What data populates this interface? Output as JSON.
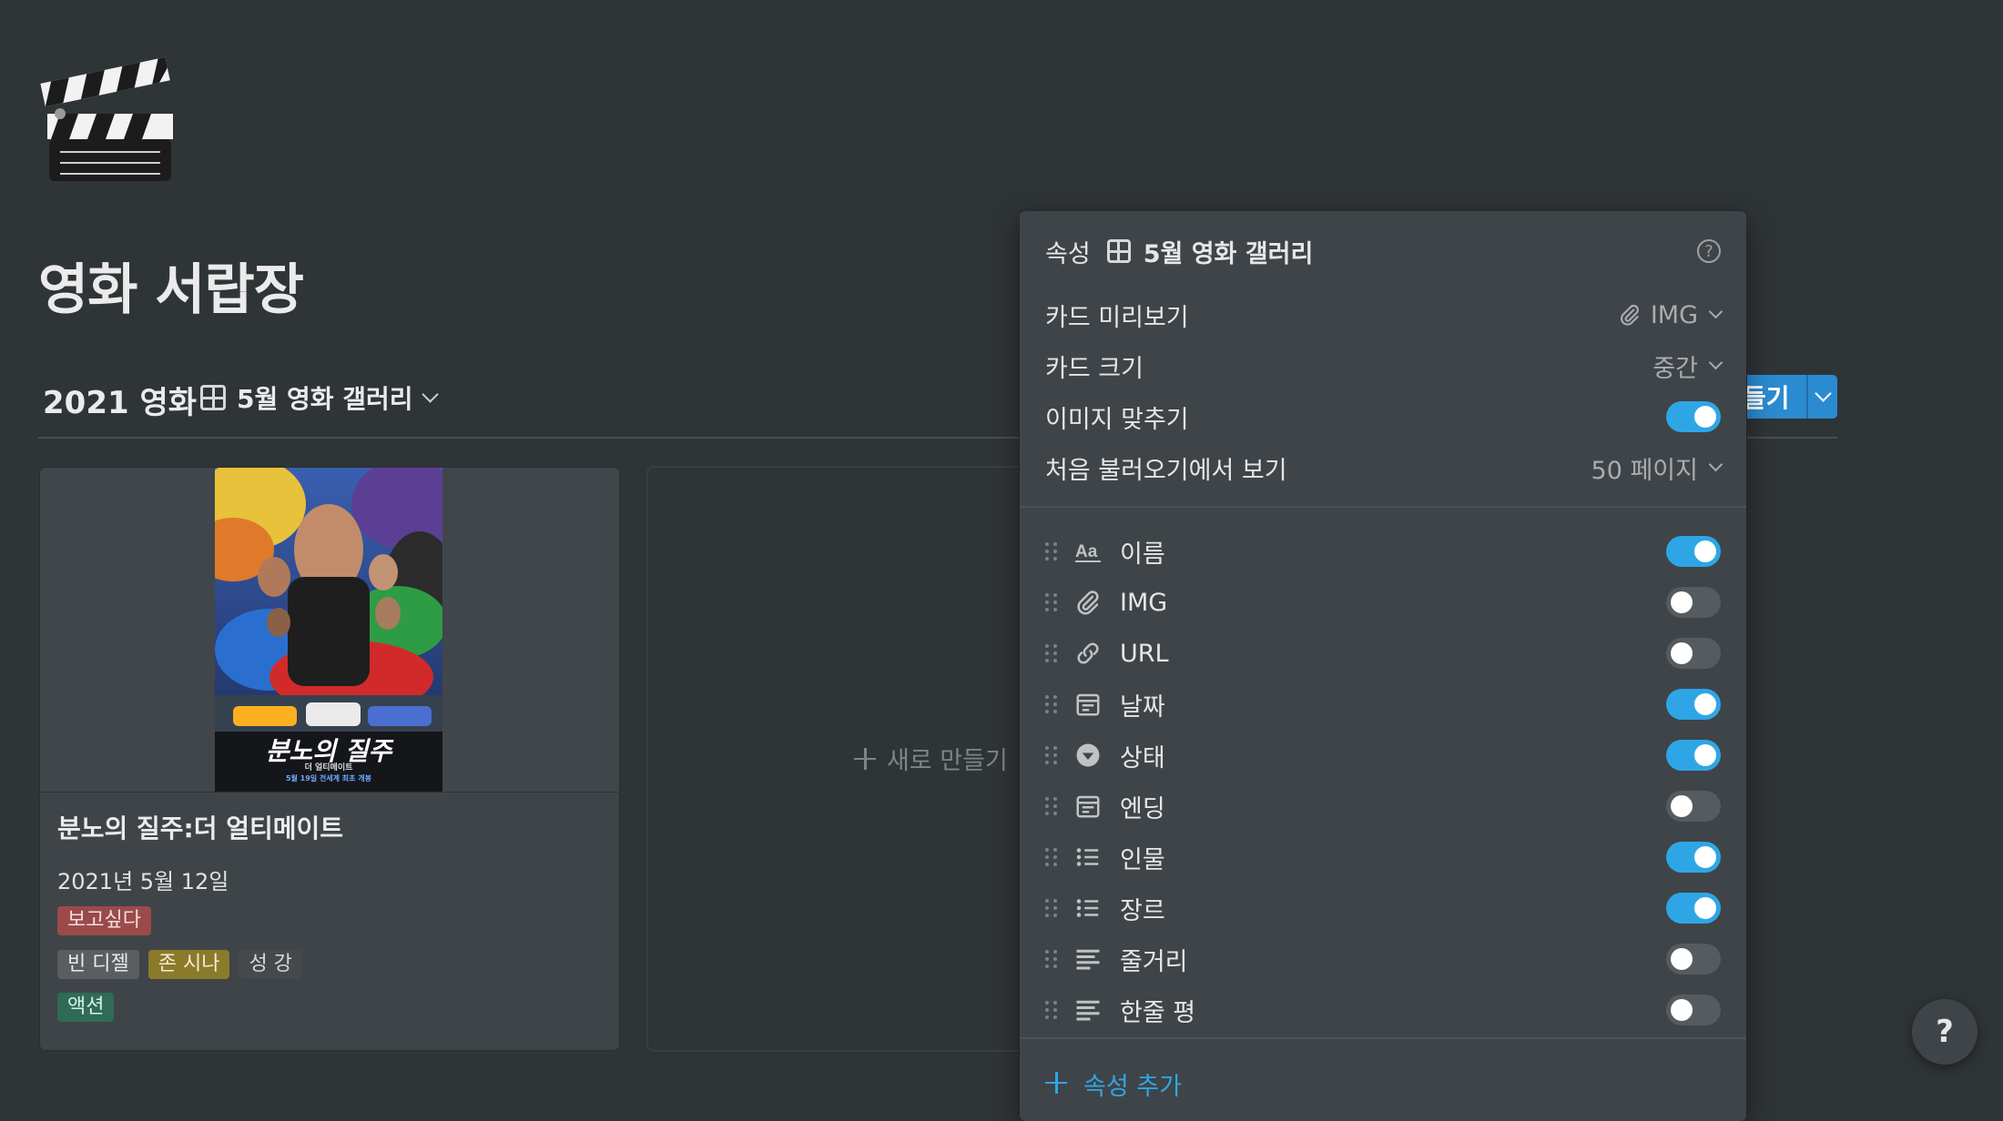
{
  "page": {
    "title": "영화 서랍장",
    "icon": "clapperboard-icon"
  },
  "view": {
    "title": "2021 영화",
    "switcher_label": "5월 영화 갤러리"
  },
  "new_button": {
    "label": "새로 만들기",
    "visible_label": "들기"
  },
  "gallery": {
    "cards": [
      {
        "name": "분노의 질주:더 얼티메이트",
        "date": "2021년 5월 12일",
        "status": "보고싶다",
        "people": [
          "빈 디젤",
          "존 시나",
          "성 강"
        ],
        "genres": [
          "액션"
        ],
        "poster": {
          "title": "분노의 질주",
          "subtitle": "더 얼티메이트",
          "release": "5월 19일 전세계 최초 개봉"
        }
      }
    ],
    "new_card_label": "새로 만들기"
  },
  "properties_panel": {
    "title": "속성",
    "view_name": "5월 영화 갤러리",
    "settings": {
      "card_preview": {
        "label": "카드 미리보기",
        "value": "IMG"
      },
      "card_size": {
        "label": "카드 크기",
        "value": "중간"
      },
      "fit_image": {
        "label": "이미지 맞추기",
        "on": true
      },
      "load_limit": {
        "label": "처음 불러오기에서 보기",
        "value": "50 페이지"
      }
    },
    "props": [
      {
        "name": "이름",
        "icon": "text-aa-icon",
        "on": true
      },
      {
        "name": "IMG",
        "icon": "paperclip-icon",
        "on": false
      },
      {
        "name": "URL",
        "icon": "link-icon",
        "on": false
      },
      {
        "name": "날짜",
        "icon": "calendar-icon",
        "on": true
      },
      {
        "name": "상태",
        "icon": "select-icon",
        "on": true
      },
      {
        "name": "엔딩",
        "icon": "calendar-icon",
        "on": false
      },
      {
        "name": "인물",
        "icon": "multi-select-icon",
        "on": true
      },
      {
        "name": "장르",
        "icon": "multi-select-icon",
        "on": true
      },
      {
        "name": "줄거리",
        "icon": "text-lines-icon",
        "on": false
      },
      {
        "name": "한줄 평",
        "icon": "text-lines-icon",
        "on": false
      }
    ],
    "add_label": "속성 추가"
  },
  "help": {
    "label": "?"
  },
  "colors": {
    "background": "#2f3437",
    "accent": "#2ea6e6",
    "tag_status": "#9b4a49",
    "tag_person_1": "#5a5e61",
    "tag_person_2": "#8c7a2b",
    "tag_genre": "#2f6b57"
  }
}
